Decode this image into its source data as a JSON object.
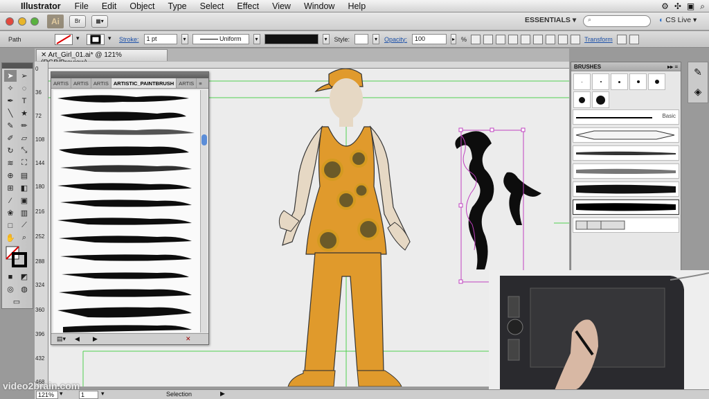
{
  "menubar": {
    "app_name": "Illustrator",
    "menus": [
      "File",
      "Edit",
      "Object",
      "Type",
      "Select",
      "Effect",
      "View",
      "Window",
      "Help"
    ]
  },
  "appbar": {
    "logo": "Ai",
    "br_label": "Br",
    "workspace": "ESSENTIALS ▾",
    "search_placeholder": "",
    "cslive": "CS Live ▾"
  },
  "controlbar": {
    "selection_type": "Path",
    "stroke_label": "Stroke:",
    "stroke_weight": "1 pt",
    "profile": "Uniform",
    "style_label": "Style:",
    "opacity_label": "Opacity:",
    "opacity_value": "100",
    "percent": "%",
    "transform_label": "Transform"
  },
  "document": {
    "tab_title": "Art_Girl_01.ai* @ 121% (RGB/Preview)"
  },
  "ruler_left_ticks": [
    "0",
    "36",
    "72",
    "108",
    "144",
    "180",
    "216",
    "252",
    "288",
    "324",
    "360",
    "396",
    "432",
    "468"
  ],
  "brush_library": {
    "tabs": [
      "ARTIS",
      "ARTIS",
      "ARTIS",
      "ARTISTIC_PAINTBRUSH",
      "ARTIS"
    ]
  },
  "brushes_panel": {
    "title": "BRUSHES",
    "basic_label": "Basic",
    "dot_sizes": [
      1,
      2,
      3,
      4,
      6,
      9,
      13
    ]
  },
  "statusbar": {
    "zoom": "121%",
    "page": "1",
    "status": "Selection"
  },
  "watermark": "video2brain.com",
  "colors": {
    "accent_blue": "#1a4fa8",
    "guide_green": "#4fd04f",
    "pants_orange": "#e09a2c",
    "path_magenta": "#c040c0"
  }
}
